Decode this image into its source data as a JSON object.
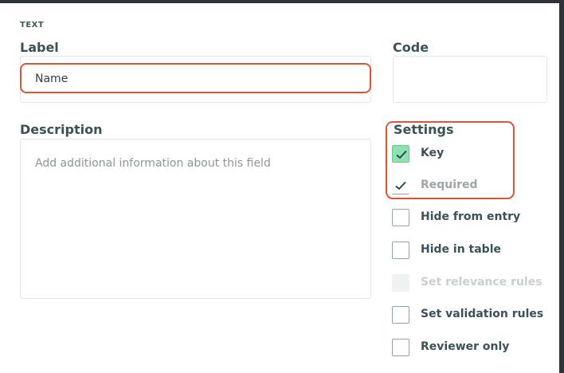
{
  "field_type": "TEXT",
  "label_section": {
    "heading": "Label",
    "value": "Name"
  },
  "code_section": {
    "heading": "Code",
    "value": ""
  },
  "description_section": {
    "heading": "Description",
    "placeholder": "Add additional information about this field"
  },
  "settings": {
    "heading": "Settings",
    "items": [
      {
        "label": "Key",
        "checked": true,
        "style": "green"
      },
      {
        "label": "Required",
        "checked": true,
        "style": "muted"
      },
      {
        "label": "Hide from entry",
        "checked": false
      },
      {
        "label": "Hide in table",
        "checked": false
      },
      {
        "label": "Set relevance rules",
        "checked": false,
        "disabled": true
      },
      {
        "label": "Set validation rules",
        "checked": false
      },
      {
        "label": "Reviewer only",
        "checked": false
      }
    ]
  },
  "colors": {
    "highlight": "#e0533a",
    "checked_green": "#8fe3b0",
    "text_heading": "#3a5257"
  }
}
